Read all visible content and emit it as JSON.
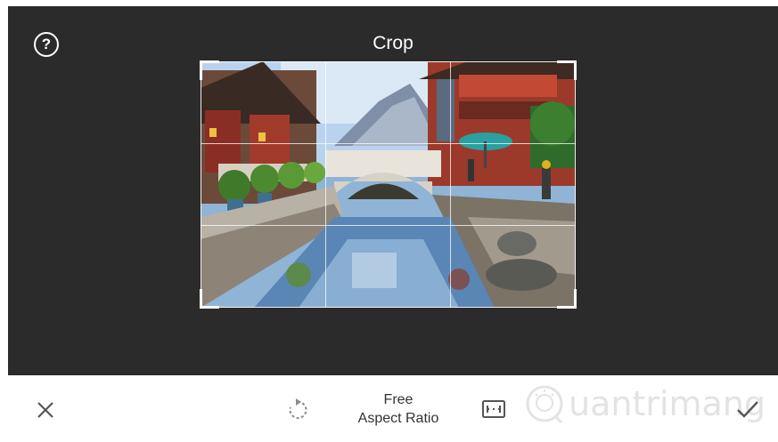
{
  "header": {
    "title": "Crop"
  },
  "toolbar": {
    "cancel_icon": "close-icon",
    "rotate_icon": "rotate-icon",
    "aspect_line1": "Free",
    "aspect_line2": "Aspect Ratio",
    "aspect_icon": "aspect-ratio-icon",
    "confirm_icon": "checkmark-icon"
  },
  "watermark": {
    "text": "uantrimang",
    "logo_letter": "Q"
  },
  "colors": {
    "editor_background": "#2b2b2b",
    "toolbar_background": "#ffffff",
    "icon_color": "#555555"
  }
}
